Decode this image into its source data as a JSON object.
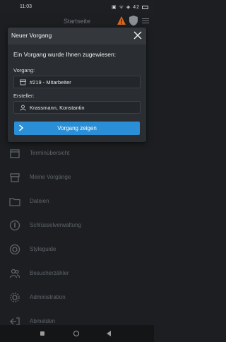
{
  "statusbar": {
    "time": "11:03",
    "icons": "▣ ᯤ ◈ 42"
  },
  "appbar": {
    "title": "Startseite"
  },
  "menu": [
    {
      "label": "Terminübersicht",
      "icon": "calendar-icon"
    },
    {
      "label": "Meine Vorgänge",
      "icon": "archive-box-icon"
    },
    {
      "label": "Dateien",
      "icon": "folder-icon"
    },
    {
      "label": "Schlüsselverwaltung",
      "icon": "key-icon"
    },
    {
      "label": "Styleguide",
      "icon": "circle-target-icon"
    },
    {
      "label": "Besucherzähler",
      "icon": "people-icon"
    },
    {
      "label": "Administration",
      "icon": "gear-icon"
    },
    {
      "label": "Abmelden",
      "icon": "logout-icon"
    }
  ],
  "dialog": {
    "title": "Neuer Vorgang",
    "message": "Ein Vorgang wurde Ihnen zugewiesen:",
    "vorgang_label": "Vorgang:",
    "vorgang_value": "#219 - Mitarbeiter",
    "ersteller_label": "Ersteller:",
    "ersteller_value": "Krassmann, Konstantin",
    "button_label": "Vorgang zeigen"
  },
  "colors": {
    "accent": "#2a8fd6",
    "warning": "#d9691e"
  }
}
